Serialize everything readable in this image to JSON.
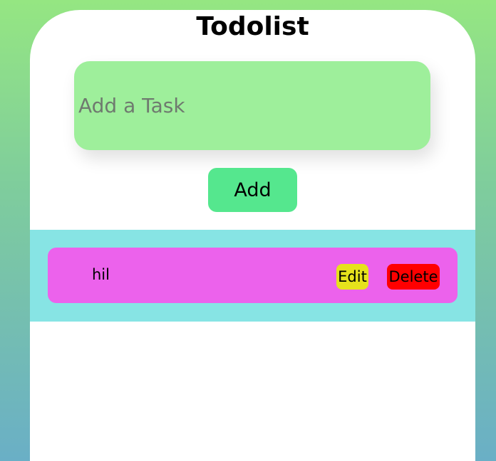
{
  "app": {
    "title": "Todolist"
  },
  "input": {
    "placeholder": "Add a Task",
    "value": ""
  },
  "add_button": {
    "label": "Add"
  },
  "tasks": [
    {
      "text": "hil",
      "edit_label": "Edit",
      "delete_label": "Delete"
    }
  ],
  "colors": {
    "background_top": "#95e682",
    "background_bottom": "#6aafc6",
    "card": "#ffffff",
    "input_background": "#9eef9b",
    "add_button": "#55e78e",
    "list_band": "#87e4e4",
    "task_row": "#ec62ec",
    "edit_button": "#e6e21c",
    "delete_button": "#ff0000"
  }
}
